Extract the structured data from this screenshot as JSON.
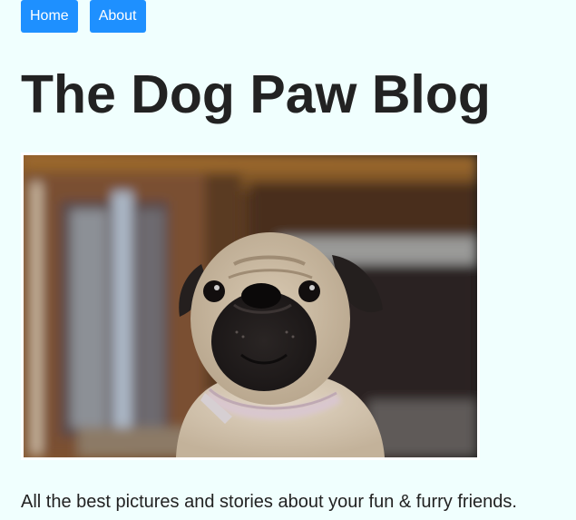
{
  "nav": {
    "items": [
      {
        "label": "Home"
      },
      {
        "label": "About"
      }
    ],
    "color": "#1e90ff"
  },
  "header": {
    "title": "The Dog Paw Blog"
  },
  "hero": {
    "image_subject": "pug-photo"
  },
  "intro": {
    "tagline": "All the best pictures and stories about your fun & furry friends."
  },
  "colors": {
    "background": "#f0fffe",
    "text": "#222222",
    "button": "#1e90ff"
  }
}
